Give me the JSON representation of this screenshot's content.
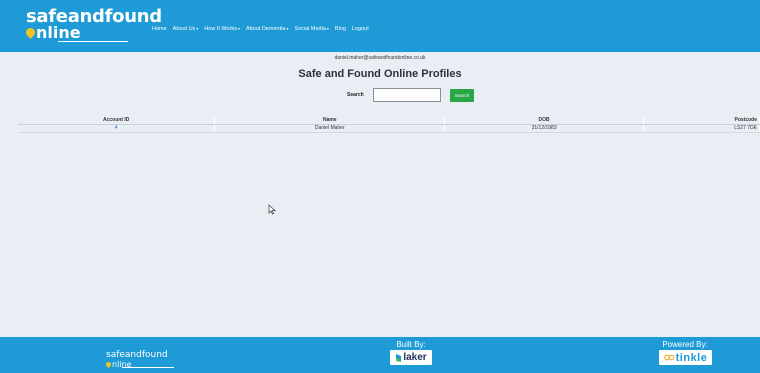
{
  "brand": {
    "line1": "safeandfound",
    "line2": "nline"
  },
  "nav": {
    "items": [
      {
        "label": "Home",
        "dropdown": false
      },
      {
        "label": "About Us",
        "dropdown": true
      },
      {
        "label": "How It Works",
        "dropdown": true
      },
      {
        "label": "About Dementia",
        "dropdown": true
      },
      {
        "label": "Social Media",
        "dropdown": true
      },
      {
        "label": "Blog",
        "dropdown": false
      },
      {
        "label": "Logout",
        "dropdown": false
      }
    ],
    "caret": "▾"
  },
  "user": {
    "email": "daniel.maher@safeandfoundonline.co.uk"
  },
  "page": {
    "title": "Safe and Found Online Profiles"
  },
  "search": {
    "label": "Search",
    "value": "",
    "placeholder": "",
    "button_label": "Search"
  },
  "table": {
    "headers": [
      "Account ID",
      "Name",
      "DOB",
      "Postcode"
    ],
    "rows": [
      {
        "account_id": "4",
        "name": "Daniel Maher",
        "dob": "31/12/1983",
        "postcode": "LS27 7DE"
      }
    ]
  },
  "footer": {
    "brand_line1": "safeandfound",
    "brand_line2": "nline",
    "built_by_label": "Built By:",
    "built_by_company": "laker",
    "powered_by_label": "Powered By:",
    "powered_by_company": "tinkle"
  },
  "colors": {
    "header_bg": "#1e9ad6",
    "page_bg": "#e9edf4",
    "search_button": "#27a745",
    "link": "#1e6fd9",
    "pin": "#f3c41c"
  },
  "icons": [
    "location-pin-icon",
    "mouse-cursor-icon",
    "laker-logo-icon",
    "tinkle-logo-icon"
  ]
}
